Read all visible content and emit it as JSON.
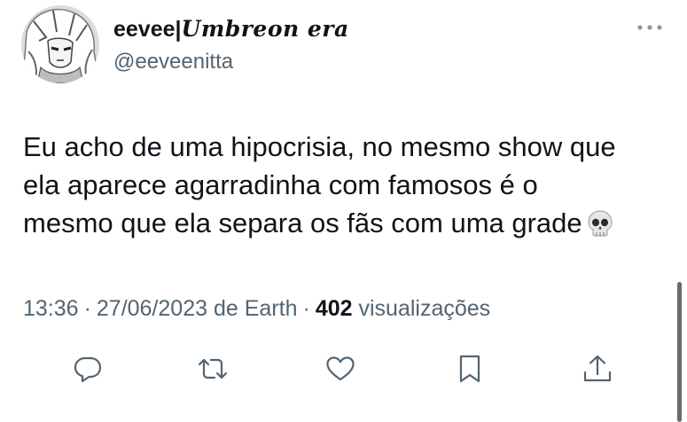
{
  "author": {
    "display_name_plain": "eevee|",
    "display_name_styled": "Umbreon era",
    "handle": "@eeveenitta",
    "avatar_icon": "anime-portrait-avatar"
  },
  "tweet": {
    "lines": [
      "Eu acho de uma hipocrisia, no mesmo show que",
      "ela aparece agarradinha com famosos é o",
      "mesmo que ela separa os fãs com uma grade"
    ],
    "emoji": "skull-emoji"
  },
  "meta": {
    "time": "13:36",
    "date": "27/06/2023",
    "source": "de Earth",
    "views_count": "402",
    "views_label": "visualizações"
  },
  "actions": {
    "icons": [
      "reply-icon",
      "retweet-icon",
      "like-icon",
      "bookmark-icon",
      "share-icon"
    ]
  },
  "colors": {
    "text_primary": "#0f1419",
    "text_secondary": "#536471",
    "background": "#ffffff"
  }
}
